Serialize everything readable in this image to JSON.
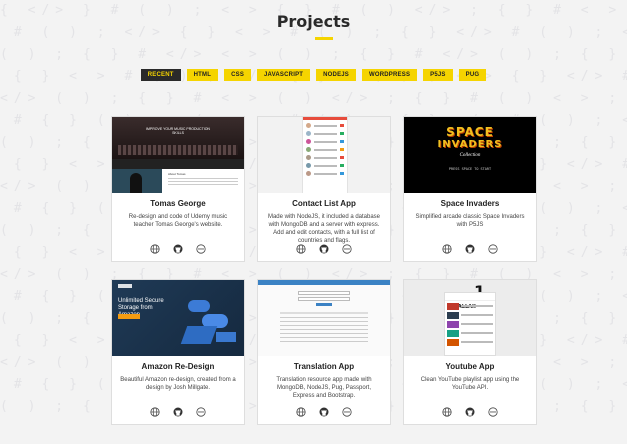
{
  "header": {
    "title": "Projects"
  },
  "filters": [
    {
      "label": "RECENT",
      "active": true
    },
    {
      "label": "HTML",
      "active": false
    },
    {
      "label": "CSS",
      "active": false
    },
    {
      "label": "JAVASCRIPT",
      "active": false
    },
    {
      "label": "NODEJS",
      "active": false
    },
    {
      "label": "WORDPRESS",
      "active": false
    },
    {
      "label": "P5JS",
      "active": false
    },
    {
      "label": "PUG",
      "active": false
    }
  ],
  "projects": [
    {
      "title": "Tomas George",
      "description": "Re-design and code of Udemy music teacher Tomas George's website.",
      "thumb": {
        "headline": "IMPROVE YOUR MUSIC PRODUCTION SKILLS",
        "caption": "About Tomas"
      }
    },
    {
      "title": "Contact List App",
      "description": "Made with NodeJS, it included a database with MongoDB and a server with express. Add and edit contacts, with a full list of countries and flags.",
      "thumb": {}
    },
    {
      "title": "Space Invaders",
      "description": "Simplified arcade classic Space Invaders with P5JS",
      "thumb": {
        "line1": "SPACE",
        "line2": "INVADERS",
        "line3": "Collection",
        "press": "PRESS SPACE TO START"
      }
    },
    {
      "title": "Amazon Re-Design",
      "description": "Beautiful Amazon re-design, created from a design by Josh Millgate.",
      "thumb": {
        "headline": "Unlimited Secure Storage from Amazon"
      }
    },
    {
      "title": "Translation App",
      "description": "Translation resource app made with MongoDB, NodeJS, Pug, Passport, Express and Bootstrap.",
      "thumb": {}
    },
    {
      "title": "Youtube App",
      "description": "Clean YouTube playlist app using the YouTube API.",
      "thumb": {
        "title": "PARALLAX",
        "badge": "1"
      }
    }
  ],
  "colors": {
    "accent": "#f5d400",
    "dark": "#2a2a2a",
    "background": "#f3f3f3"
  },
  "icons": [
    "globe-icon",
    "github-icon",
    "more-icon"
  ]
}
